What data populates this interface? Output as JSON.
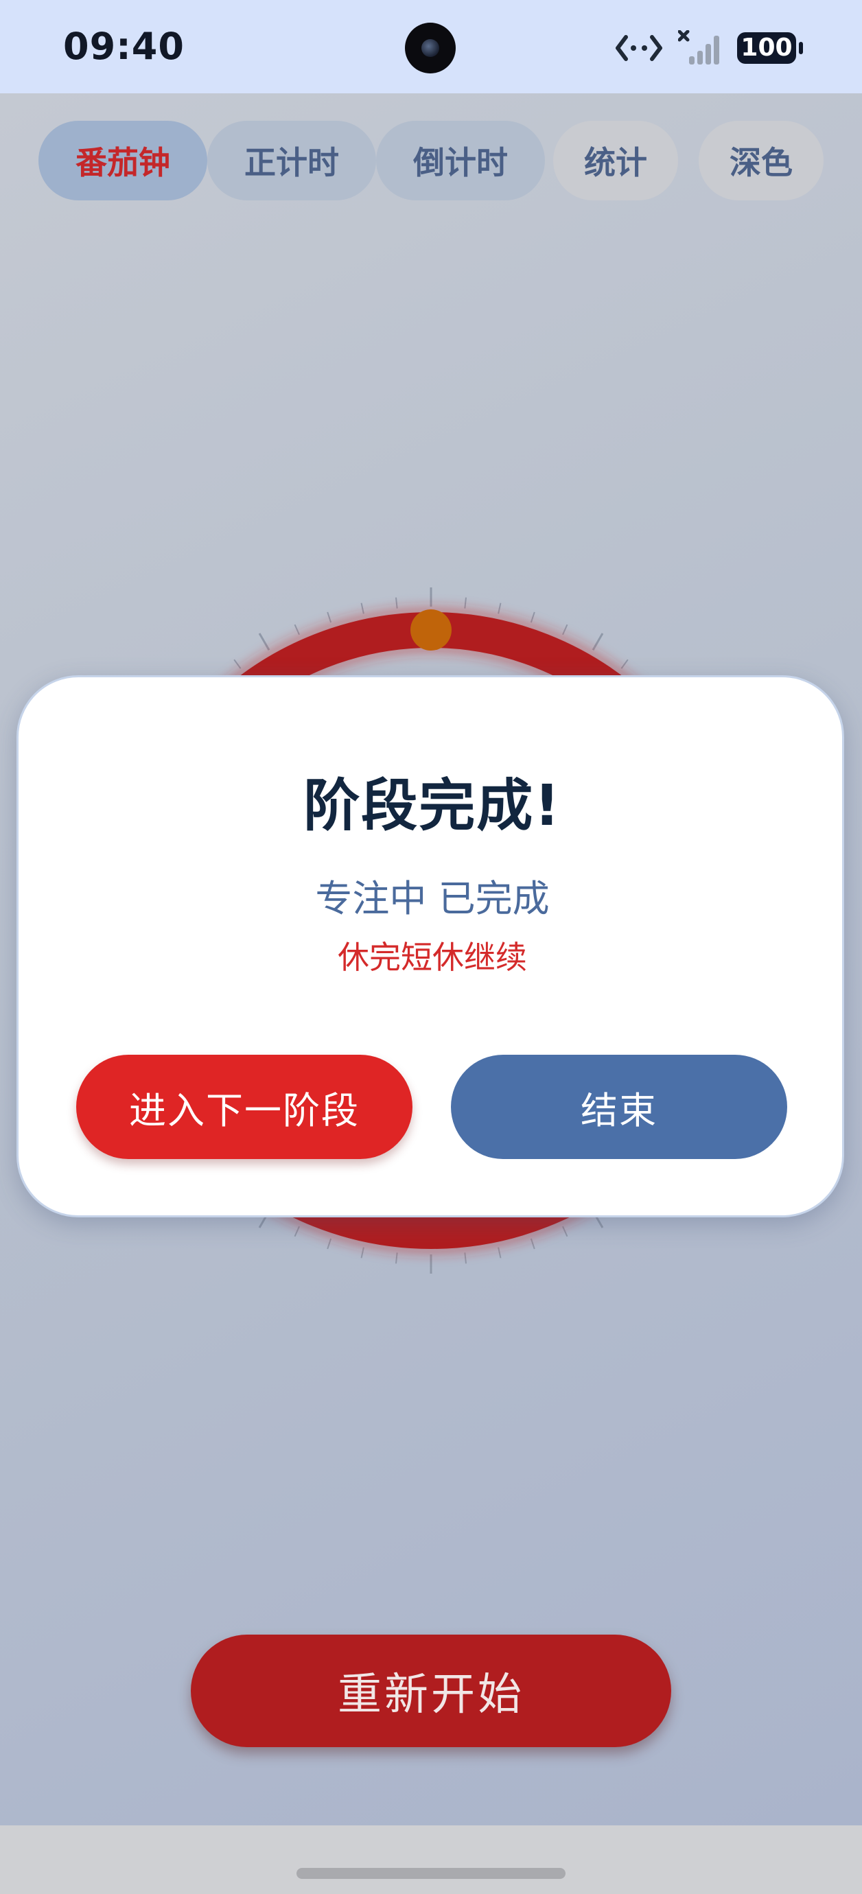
{
  "status_bar": {
    "time": "09:40",
    "battery": "100",
    "icons": [
      "data-transfer-icon",
      "no-signal-icon",
      "battery-icon"
    ]
  },
  "tabs": [
    {
      "label": "番茄钟",
      "active": true
    },
    {
      "label": "正计时",
      "active": false
    },
    {
      "label": "倒计时",
      "active": false
    },
    {
      "label": "统计",
      "active": false
    },
    {
      "label": "深色",
      "active": false
    }
  ],
  "dialog": {
    "title": "阶段完成!",
    "subtitle": "专注中 已完成",
    "hint": "休完短休继续",
    "primary_button": "进入下一阶段",
    "secondary_button": "结束"
  },
  "restart_button": "重新开始",
  "colors": {
    "accent_red": "#df2525",
    "dial_red": "#b01d1f",
    "knob": "#c0640a",
    "secondary_blue": "#4b70a8",
    "active_tab_text": "#c4272a"
  }
}
